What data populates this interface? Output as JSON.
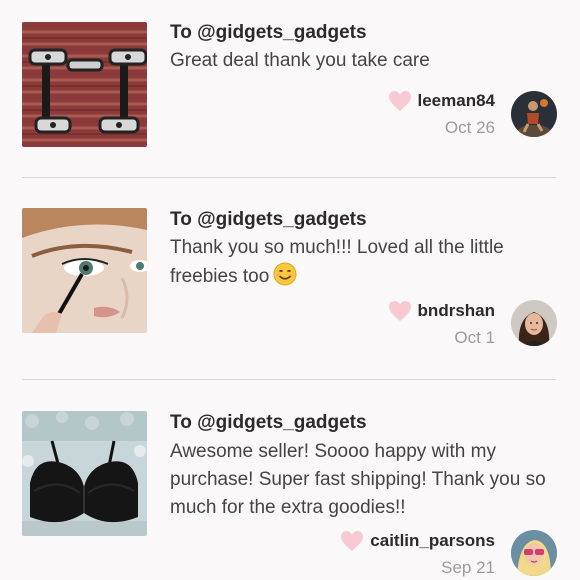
{
  "notes": [
    {
      "to": "To @gidgets_gadgets",
      "message": "Great deal thank you take care",
      "username": "leeman84",
      "date": "Oct 26",
      "thumb": "handles-on-rug-image"
    },
    {
      "to": "To @gidgets_gadgets",
      "message": "Thank you so much!!! Loved all the little freebies too",
      "username": "bndrshan",
      "date": "Oct 1",
      "thumb": "eyeliner-closeup-image",
      "emoji": "smiling-face-emoji"
    },
    {
      "to": "To @gidgets_gadgets",
      "message": "Awesome seller! Soooo happy with my purchase! Super fast shipping! Thank you so much for the extra goodies!!",
      "username": "caitlin_parsons",
      "date": "Sep 21",
      "thumb": "black-bra-image"
    }
  ],
  "colors": {
    "background": "#fbf8f9",
    "heart": "#f7c9d3",
    "divider": "#d9d6d7",
    "date": "#9b9b9b"
  }
}
